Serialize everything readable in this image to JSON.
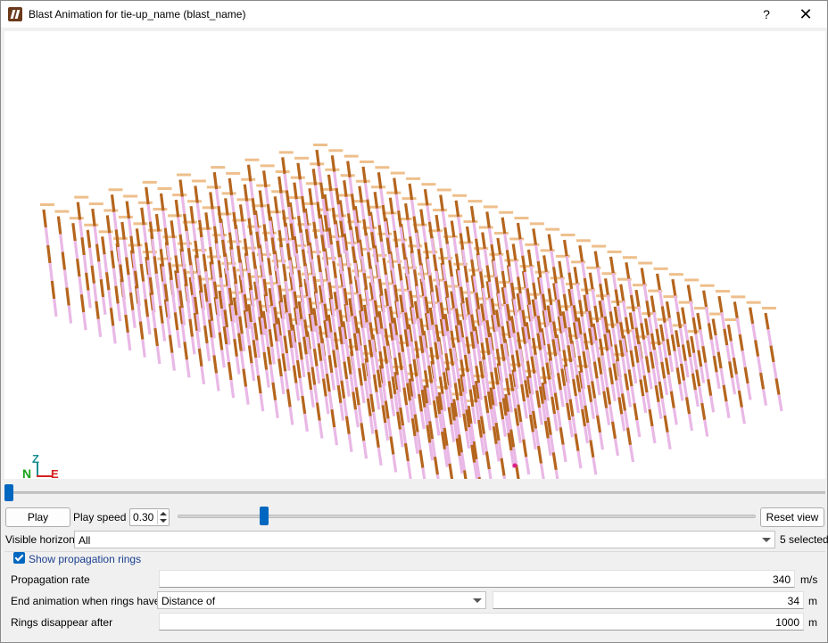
{
  "window": {
    "title": "Blast Animation for tie-up_name (blast_name)",
    "help_label": "?",
    "close_label": "✕"
  },
  "viewport": {
    "axes": {
      "z": "Z",
      "n": "N",
      "e": "E"
    },
    "scene": "blast hole ring layout",
    "colors": {
      "hole_charge": "#b5651d",
      "hole_stemming": "#e9b8e6",
      "label": "#e08a2e",
      "initiation_point": "#e0208a"
    }
  },
  "timeline": {
    "position_fraction": 0.0
  },
  "controls": {
    "play_label": "Play",
    "play_speed_label": "Play speed",
    "play_speed_value": "0.30",
    "play_speed_fraction": 0.15,
    "reset_view_label": "Reset view"
  },
  "horizons": {
    "label": "Visible horizons",
    "selected_value": "All",
    "selected_count": "5 selected"
  },
  "rings": {
    "show_label": "Show propagation rings",
    "show_checked": true,
    "propagation_rate_label": "Propagation rate",
    "propagation_rate_value": "340",
    "propagation_rate_unit": "m/s",
    "end_label": "End animation when rings have a",
    "end_mode": "Distance of",
    "end_value": "34",
    "end_unit": "m",
    "disappear_label": "Rings disappear after",
    "disappear_value": "1000",
    "disappear_unit": "m"
  },
  "accent_color": "#0067c0"
}
